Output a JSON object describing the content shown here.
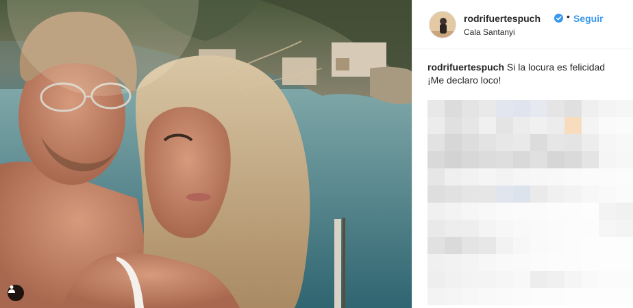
{
  "post": {
    "photo_description_icon": "user-tag-icon"
  },
  "header": {
    "username": "rodrifuertespuch",
    "verified_icon": "verified-badge-icon",
    "separator": "•",
    "follow_label": "Seguir",
    "location": "Cala Santanyi"
  },
  "caption": {
    "username": "rodrifuertespuch",
    "text_line1": "Si la locura es felicidad",
    "text_line2": "¡Me declaro loco!"
  },
  "comments": {
    "state": "pixelated"
  },
  "colors": {
    "follow": "#3897f0",
    "text": "#262626",
    "border": "#efefef"
  }
}
